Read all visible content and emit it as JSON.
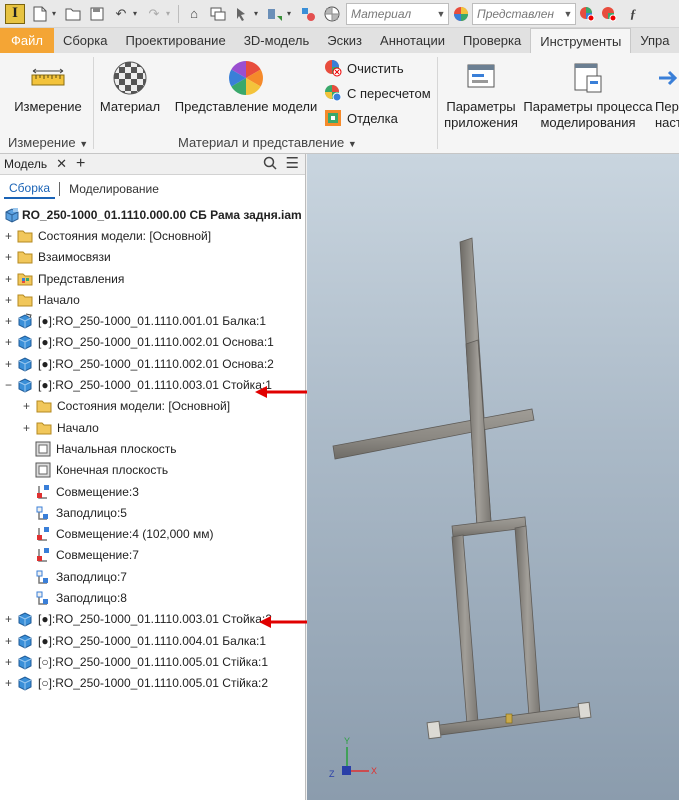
{
  "quick_access": {
    "material_combo": "Материал",
    "appearance_combo": "Представлен"
  },
  "menu": {
    "tabs": [
      "Файл",
      "Сборка",
      "Проектирование",
      "3D-модель",
      "Эскиз",
      "Аннотации",
      "Проверка",
      "Инструменты",
      "Упра"
    ],
    "active": "Инструменты"
  },
  "ribbon": {
    "measure_button": "Измерение",
    "measure_group": "Измерение",
    "material_button": "Материал",
    "appearance_button": "Представление модели",
    "clear_button": "Очистить",
    "recalc_button": "С пересчетом",
    "finish_button": "Отделка",
    "material_group": "Материал и представление",
    "app_options_line1": "Параметры",
    "app_options_line2": "приложения",
    "modeling_params_line1": "Параметры процесса",
    "modeling_params_line2": "моделирования",
    "cut_line1": "Пер",
    "cut_line2": "наст"
  },
  "browser": {
    "panel_title": "Модель",
    "tab_assembly": "Сборка",
    "tab_modeling": "Моделирование",
    "root": "RO_250-1000_01.1110.000.00 СБ Рама задня.iam",
    "nodes": [
      "Состояния модели: [Основной]",
      "Взаимосвязи",
      "Представления",
      "Начало",
      "[●]:RO_250-1000_01.1110.001.01 Балка:1",
      "[●]:RO_250-1000_01.1110.002.01 Основа:1",
      "[●]:RO_250-1000_01.1110.002.01 Основа:2",
      "[●]:RO_250-1000_01.1110.003.01 Стойка:1",
      "Состояния модели: [Основной]",
      "Начало",
      "Начальная плоскость",
      "Конечная плоскость",
      "Совмещение:3",
      "Заподлицо:5",
      "Совмещение:4 (102,000 мм)",
      "Совмещение:7",
      "Заподлицо:7",
      "Заподлицо:8",
      "[●]:RO_250-1000_01.1110.003.01 Стойка:2",
      "[●]:RO_250-1000_01.1110.004.01 Балка:1",
      "[○]:RO_250-1000_01.1110.005.01 Стійка:1",
      "[○]:RO_250-1000_01.1110.005.01 Стійка:2"
    ]
  },
  "viewport": {
    "axis_x": "X",
    "axis_y": "Y",
    "axis_z": "Z"
  },
  "colors": {
    "file_tab": "#f4a535",
    "annotation_arrow": "#e00000",
    "part_blue": "#3a8fd8",
    "folder_yellow": "#f1c75b",
    "model_gray": "#8f8c86"
  }
}
